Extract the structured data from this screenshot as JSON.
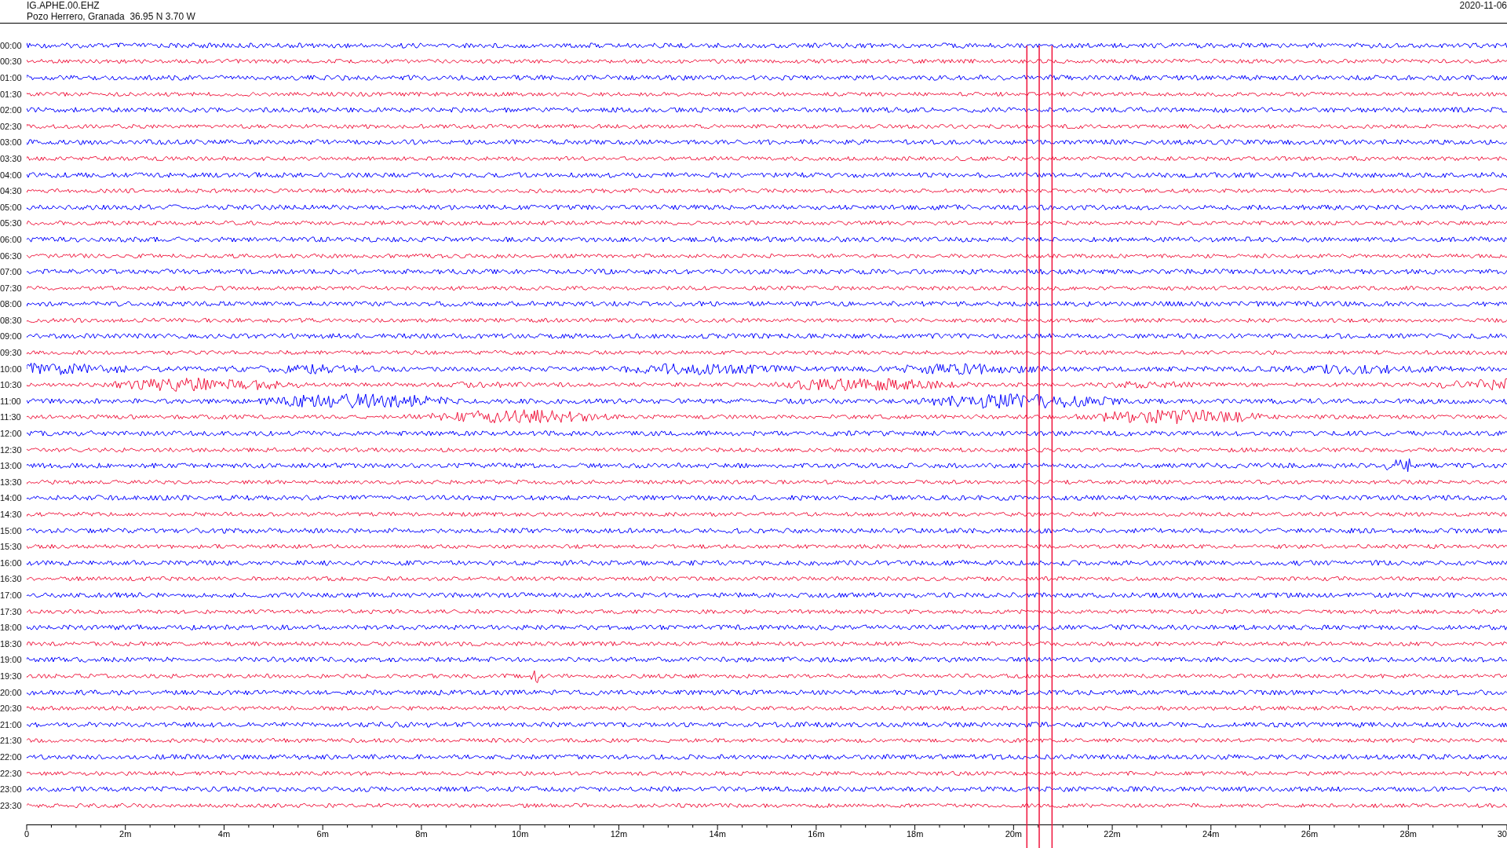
{
  "header": {
    "station": "IG.APHE.00.EHZ",
    "location": "Pozo Herrero, Granada  36.95 N 3.70 W",
    "date": "2020-11-06"
  },
  "rows": [
    {
      "label": "00:00",
      "color": "#0000ff"
    },
    {
      "label": "00:30",
      "color": "#f0143c"
    },
    {
      "label": "01:00",
      "color": "#0000ff"
    },
    {
      "label": "01:30",
      "color": "#f0143c"
    },
    {
      "label": "02:00",
      "color": "#0000ff"
    },
    {
      "label": "02:30",
      "color": "#f0143c"
    },
    {
      "label": "03:00",
      "color": "#0000ff"
    },
    {
      "label": "03:30",
      "color": "#f0143c"
    },
    {
      "label": "04:00",
      "color": "#0000ff"
    },
    {
      "label": "04:30",
      "color": "#f0143c"
    },
    {
      "label": "05:00",
      "color": "#0000ff"
    },
    {
      "label": "05:30",
      "color": "#f0143c"
    },
    {
      "label": "06:00",
      "color": "#0000ff"
    },
    {
      "label": "06:30",
      "color": "#f0143c"
    },
    {
      "label": "07:00",
      "color": "#0000ff"
    },
    {
      "label": "07:30",
      "color": "#f0143c"
    },
    {
      "label": "08:00",
      "color": "#0000ff"
    },
    {
      "label": "08:30",
      "color": "#f0143c"
    },
    {
      "label": "09:00",
      "color": "#0000ff"
    },
    {
      "label": "09:30",
      "color": "#f0143c"
    },
    {
      "label": "10:00",
      "color": "#0000ff"
    },
    {
      "label": "10:30",
      "color": "#f0143c"
    },
    {
      "label": "11:00",
      "color": "#0000ff"
    },
    {
      "label": "11:30",
      "color": "#f0143c"
    },
    {
      "label": "12:00",
      "color": "#0000ff"
    },
    {
      "label": "12:30",
      "color": "#f0143c"
    },
    {
      "label": "13:00",
      "color": "#0000ff"
    },
    {
      "label": "13:30",
      "color": "#f0143c"
    },
    {
      "label": "14:00",
      "color": "#0000ff"
    },
    {
      "label": "14:30",
      "color": "#f0143c"
    },
    {
      "label": "15:00",
      "color": "#0000ff"
    },
    {
      "label": "15:30",
      "color": "#f0143c"
    },
    {
      "label": "16:00",
      "color": "#0000ff"
    },
    {
      "label": "16:30",
      "color": "#f0143c"
    },
    {
      "label": "17:00",
      "color": "#0000ff"
    },
    {
      "label": "17:30",
      "color": "#f0143c"
    },
    {
      "label": "18:00",
      "color": "#0000ff"
    },
    {
      "label": "18:30",
      "color": "#f0143c"
    },
    {
      "label": "19:00",
      "color": "#0000ff"
    },
    {
      "label": "19:30",
      "color": "#f0143c"
    },
    {
      "label": "20:00",
      "color": "#0000ff"
    },
    {
      "label": "20:30",
      "color": "#f0143c"
    },
    {
      "label": "21:00",
      "color": "#0000ff"
    },
    {
      "label": "21:30",
      "color": "#f0143c"
    },
    {
      "label": "22:00",
      "color": "#0000ff"
    },
    {
      "label": "22:30",
      "color": "#f0143c"
    },
    {
      "label": "23:00",
      "color": "#0000ff"
    },
    {
      "label": "23:30",
      "color": "#f0143c"
    }
  ],
  "axis": {
    "ticks": [
      "0",
      "2m",
      "4m",
      "6m",
      "8m",
      "10m",
      "12m",
      "14m",
      "16m",
      "18m",
      "20m",
      "22m",
      "24m",
      "26m",
      "28m",
      "30"
    ]
  }
}
